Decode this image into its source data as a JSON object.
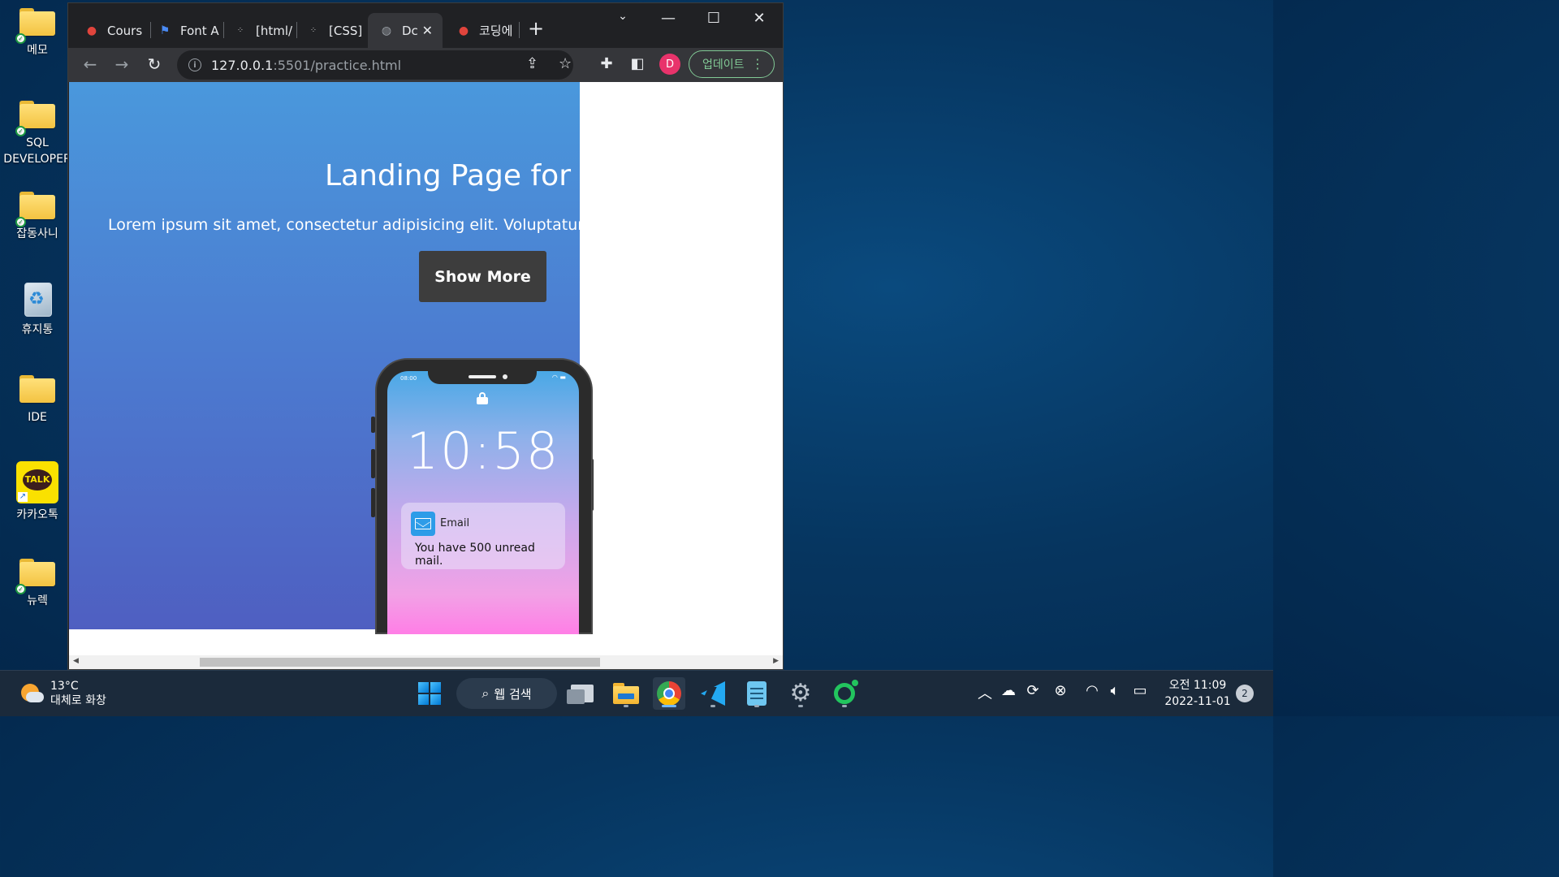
{
  "desktop": {
    "icons": [
      {
        "label": "메모",
        "icon": "folder-icon"
      },
      {
        "label": "SQL DEVELOPER",
        "icon": "folder-icon"
      },
      {
        "label": "잡동사니",
        "icon": "folder-icon"
      },
      {
        "label": "휴지통",
        "icon": "recycle-bin-icon"
      },
      {
        "label": "IDE",
        "icon": "folder-icon"
      },
      {
        "label": "카카오톡",
        "icon": "kakaotalk-icon",
        "badge_text": "TALK"
      },
      {
        "label": "뉴렉",
        "icon": "folder-icon"
      }
    ]
  },
  "browser": {
    "tabs": [
      {
        "title": "Cours",
        "favicon": "apple-icon",
        "active": false
      },
      {
        "title": "Font A",
        "favicon": "flag-icon",
        "active": false
      },
      {
        "title": "[html/",
        "favicon": "dots-icon",
        "active": false
      },
      {
        "title": "[CSS]",
        "favicon": "dots-icon",
        "active": false
      },
      {
        "title": "Dc",
        "favicon": "globe-icon",
        "active": true
      },
      {
        "title": "코딩에",
        "favicon": "apple-icon",
        "active": false
      }
    ],
    "url_host": "127.0.0.1",
    "url_rest": ":5501/practice.html",
    "profile_initial": "D",
    "update_label": "업데이트",
    "accent_color": "#81c995"
  },
  "page": {
    "title": "Landing Page for A",
    "lorem": "Lorem ipsum sit amet, consectetur adipisicing elit. Voluptatum,",
    "show_more": "Show More",
    "phone": {
      "status_time": "08:00",
      "lock_time": "10:58",
      "notif_app": "Email",
      "notif_body": "You have 500 unread mail."
    },
    "hero_gradient_top": "#4a98dc",
    "hero_gradient_bottom": "#4f5fc1",
    "button_color": "#3d3d3d"
  },
  "taskbar": {
    "weather_temp": "13°C",
    "weather_desc": "대체로 화창",
    "search_label": "웹 검색",
    "clock_ampm_time": "오전 11:09",
    "clock_date": "2022-11-01",
    "notification_count": "2"
  }
}
